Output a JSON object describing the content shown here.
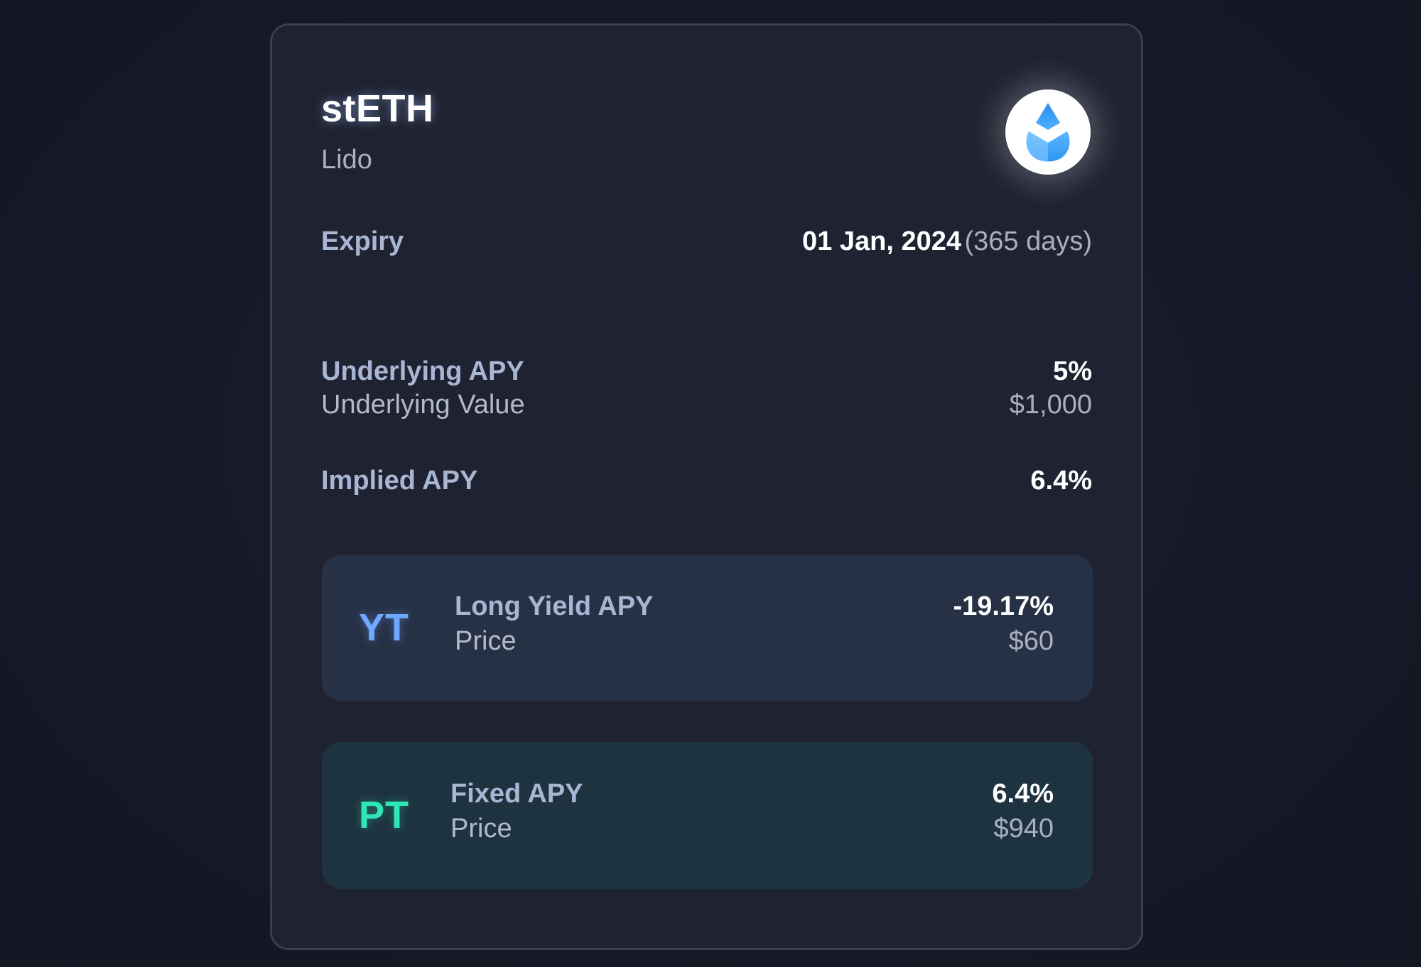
{
  "asset": {
    "name": "stETH",
    "protocol": "Lido",
    "logo_icon": "lido-drop-icon"
  },
  "details": {
    "expiry_label": "Expiry",
    "expiry_date": "01 Jan, 2024",
    "expiry_days": "(365 days)",
    "underlying_apy_label": "Underlying APY",
    "underlying_apy_value": "5%",
    "underlying_value_label": "Underlying Value",
    "underlying_value_value": "$1,000",
    "implied_apy_label": "Implied APY",
    "implied_apy_value": "6.4%"
  },
  "yt": {
    "tag": "YT",
    "apy_label": "Long Yield APY",
    "apy_value": "-19.17%",
    "price_label": "Price",
    "price_value": "$60",
    "accent": "#6ea8ff"
  },
  "pt": {
    "tag": "PT",
    "apy_label": "Fixed APY",
    "apy_value": "6.4%",
    "price_label": "Price",
    "price_value": "$940",
    "accent": "#2ee6b6"
  }
}
